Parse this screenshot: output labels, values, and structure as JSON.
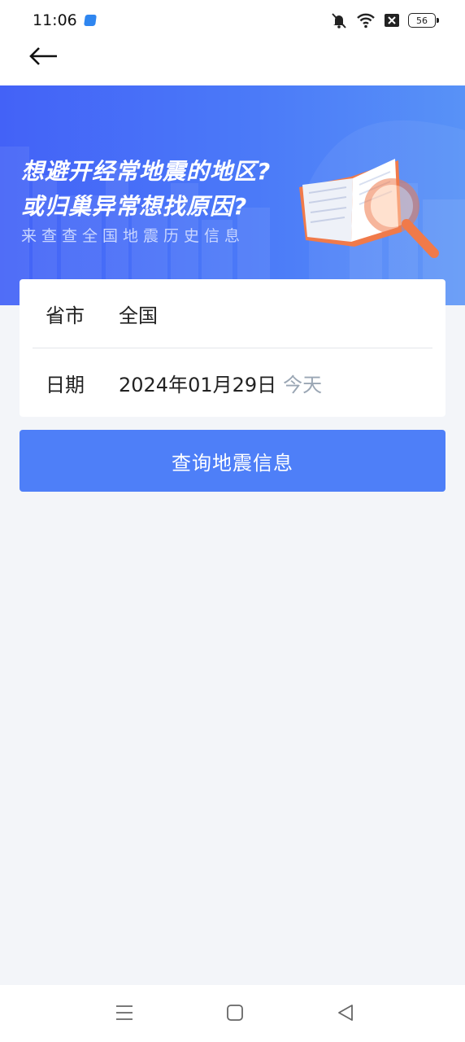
{
  "status_bar": {
    "time": "11:06",
    "battery": "56",
    "icons": [
      "app-notification-icon",
      "mute-bell-icon",
      "wifi-icon",
      "no-sim-icon",
      "battery-icon"
    ]
  },
  "top_nav": {
    "back_icon": "arrow-left-icon"
  },
  "banner": {
    "line1": "想避开经常地震的地区?",
    "line2": "或归巢异常想找原因?",
    "subtitle": "来查查全国地震历史信息",
    "illustration": "book-magnifier-illustration"
  },
  "form": {
    "region_label": "省市",
    "region_value": "全国",
    "date_label": "日期",
    "date_value": "2024年01月29日",
    "date_hint": "今天"
  },
  "query_button": {
    "label": "查询地震信息"
  },
  "nav_bar": {
    "icons": [
      "menu-icon",
      "home-square-icon",
      "back-triangle-icon"
    ]
  },
  "colors": {
    "banner_start": "#4362f7",
    "banner_end": "#5892f7",
    "button": "#4e7ff8",
    "page_bg": "#f3f5f9",
    "hint_text": "#9aa6b4"
  }
}
